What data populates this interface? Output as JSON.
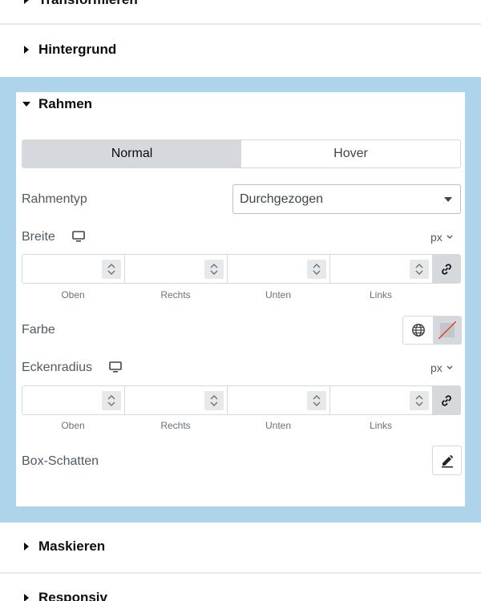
{
  "sections": {
    "transformieren": "Transformieren",
    "hintergrund": "Hintergrund",
    "rahmen": "Rahmen",
    "maskieren": "Maskieren",
    "responsiv": "Responsiv"
  },
  "tabs": {
    "normal": "Normal",
    "hover": "Hover"
  },
  "rahmentyp": {
    "label": "Rahmentyp",
    "value": "Durchgezogen"
  },
  "breite": {
    "label": "Breite",
    "unit": "px",
    "sides": [
      "Oben",
      "Rechts",
      "Unten",
      "Links"
    ]
  },
  "farbe": {
    "label": "Farbe"
  },
  "eckenradius": {
    "label": "Eckenradius",
    "unit": "px",
    "sides": [
      "Oben",
      "Rechts",
      "Unten",
      "Links"
    ]
  },
  "box_schatten": {
    "label": "Box-Schatten"
  },
  "colors": {
    "highlight": "#add4ea",
    "tab_active": "#d5d8dc",
    "no_color_slash": "#e0412b"
  }
}
